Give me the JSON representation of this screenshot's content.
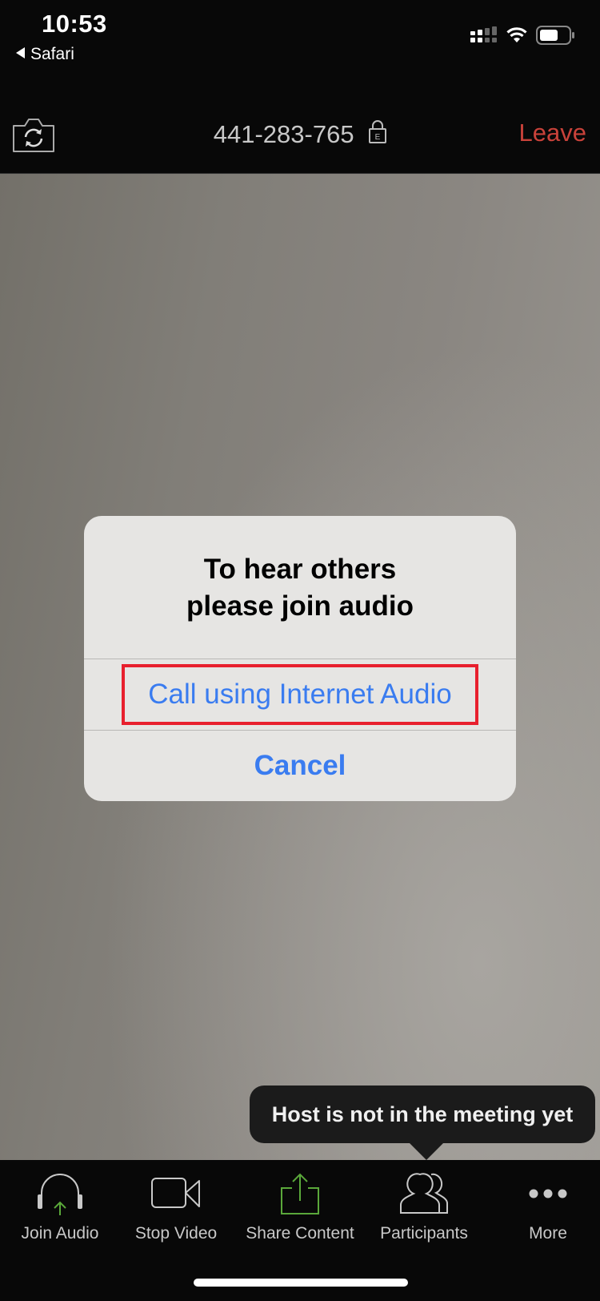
{
  "status_bar": {
    "time": "10:53",
    "back_app": "Safari",
    "icons": [
      "cellular-signal-icon",
      "wifi-icon",
      "battery-icon"
    ]
  },
  "header": {
    "meeting_id": "441-283-765",
    "lock_badge": "E",
    "leave_label": "Leave",
    "icons": [
      "camera-switch-icon",
      "lock-icon"
    ]
  },
  "dialog": {
    "title_line1": "To hear others",
    "title_line2": "please join audio",
    "primary_button": "Call using Internet Audio",
    "cancel_button": "Cancel"
  },
  "tooltip": {
    "text": "Host is not in the meeting yet"
  },
  "toolbar": {
    "items": [
      {
        "label": "Join Audio",
        "icon": "headphones-icon"
      },
      {
        "label": "Stop Video",
        "icon": "video-camera-icon"
      },
      {
        "label": "Share Content",
        "icon": "share-icon"
      },
      {
        "label": "Participants",
        "icon": "participants-icon"
      },
      {
        "label": "More",
        "icon": "more-icon"
      }
    ]
  },
  "colors": {
    "leave": "#c9423a",
    "dialog_button": "#3a7cf0",
    "highlight": "#e8202e",
    "accent_green": "#5aa83a"
  }
}
